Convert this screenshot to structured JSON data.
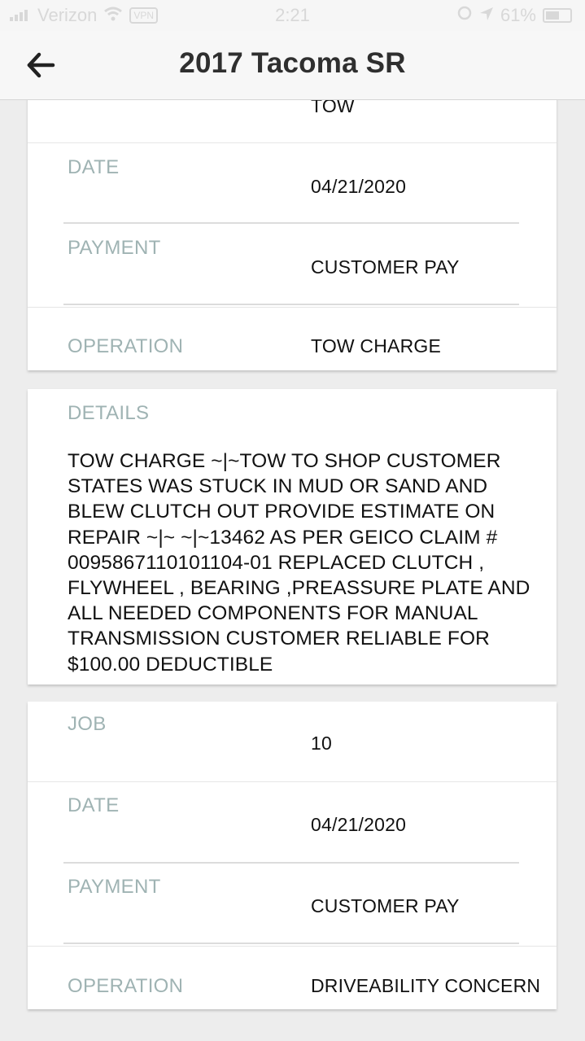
{
  "status_bar": {
    "carrier": "Verizon",
    "vpn": "VPN",
    "time": "2:21",
    "battery": "61%",
    "battery_level": 0.61
  },
  "header": {
    "title": "2017 Tacoma SR"
  },
  "card1": {
    "top_value_partial": "TOW",
    "date_label": "DATE",
    "date_value": "04/21/2020",
    "payment_label": "PAYMENT",
    "payment_value": "CUSTOMER PAY",
    "operation_label": "OPERATION",
    "operation_value": "TOW CHARGE"
  },
  "details": {
    "label": "DETAILS",
    "text": "TOW CHARGE ~|~TOW TO SHOP CUSTOMER STATES WAS STUCK IN MUD OR SAND AND BLEW CLUTCH OUT PROVIDE ESTIMATE ON REPAIR ~|~ ~|~13462 AS PER GEICO CLAIM # 0095867110101104-01 REPLACED CLUTCH , FLYWHEEL , BEARING ,PREASSURE PLATE AND ALL NEEDED COMPONENTS FOR MANUAL TRANSMISSION CUSTOMER RELIABLE FOR $100.00 DEDUCTIBLE"
  },
  "card2": {
    "job_label": "JOB",
    "job_value": "10",
    "date_label": "DATE",
    "date_value": "04/21/2020",
    "payment_label": "PAYMENT",
    "payment_value": "CUSTOMER PAY",
    "operation_label": "OPERATION",
    "operation_value": "DRIVEABILITY CONCERN"
  },
  "colors": {
    "label": "#9fb3b3",
    "value": "#111111",
    "background": "#ededed",
    "card": "#ffffff"
  }
}
